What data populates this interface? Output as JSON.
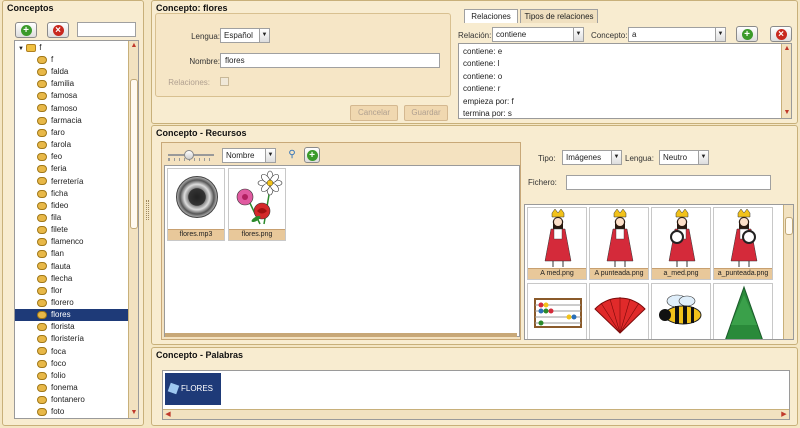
{
  "conceptos": {
    "title": "Conceptos",
    "search_value": "",
    "tree_root": "f",
    "items": [
      "f",
      "falda",
      "familia",
      "famosa",
      "famoso",
      "farmacia",
      "faro",
      "farola",
      "feo",
      "feria",
      "ferretería",
      "ficha",
      "fideo",
      "fila",
      "filete",
      "flamenco",
      "flan",
      "flauta",
      "flecha",
      "flor",
      "florero",
      "flores",
      "florista",
      "floristería",
      "foca",
      "foco",
      "folio",
      "fonema",
      "fontanero",
      "foto"
    ],
    "selected": "flores"
  },
  "concepto": {
    "title": "Concepto: flores",
    "lengua_label": "Lengua:",
    "lengua_value": "Español",
    "nombre_label": "Nombre:",
    "nombre_value": "flores",
    "relaciones_label": "Relaciones:",
    "cancel_label": "Cancelar",
    "save_label": "Guardar"
  },
  "relaciones": {
    "tabs": [
      "Relaciones",
      "Tipos de relaciones"
    ],
    "relacion_label": "Relación:",
    "relacion_value": "contiene",
    "concepto_label": "Concepto:",
    "concepto_value": "a",
    "items": [
      "contiene: e",
      "contiene: l",
      "contiene: o",
      "contiene: r",
      "empieza por: f",
      "termina por: s"
    ]
  },
  "recursos": {
    "title": "Concepto - Recursos",
    "sort_value": "Nombre",
    "files": [
      "flores.mp3",
      "flores.png"
    ],
    "tipo_label": "Tipo:",
    "tipo_value": "Imágenes",
    "lengua_label": "Lengua:",
    "lengua_value": "Neutro",
    "fichero_label": "Fichero:",
    "fichero_value": "",
    "gallery": [
      "A med.png",
      "A punteada.png",
      "a_med.png",
      "a_punteada.png",
      "",
      "",
      "",
      ""
    ]
  },
  "palabras": {
    "title": "Concepto - Palabras",
    "items": [
      "FLORES"
    ]
  }
}
